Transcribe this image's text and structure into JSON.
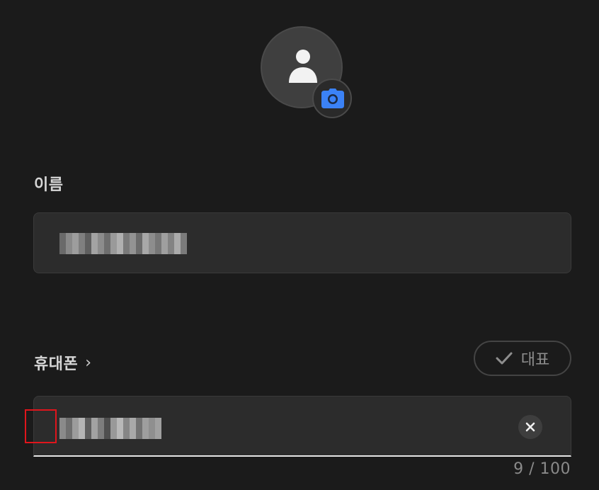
{
  "profile": {
    "avatar_icon": "person-icon",
    "camera_icon": "camera-icon",
    "accent_color": "#3b82f6"
  },
  "name_section": {
    "label": "이름"
  },
  "phone_section": {
    "label": "휴대폰",
    "chevron": "›",
    "representative_label": "대표",
    "check_icon": "check-icon",
    "clear_icon": "close-icon",
    "counter": "9 / 100"
  }
}
